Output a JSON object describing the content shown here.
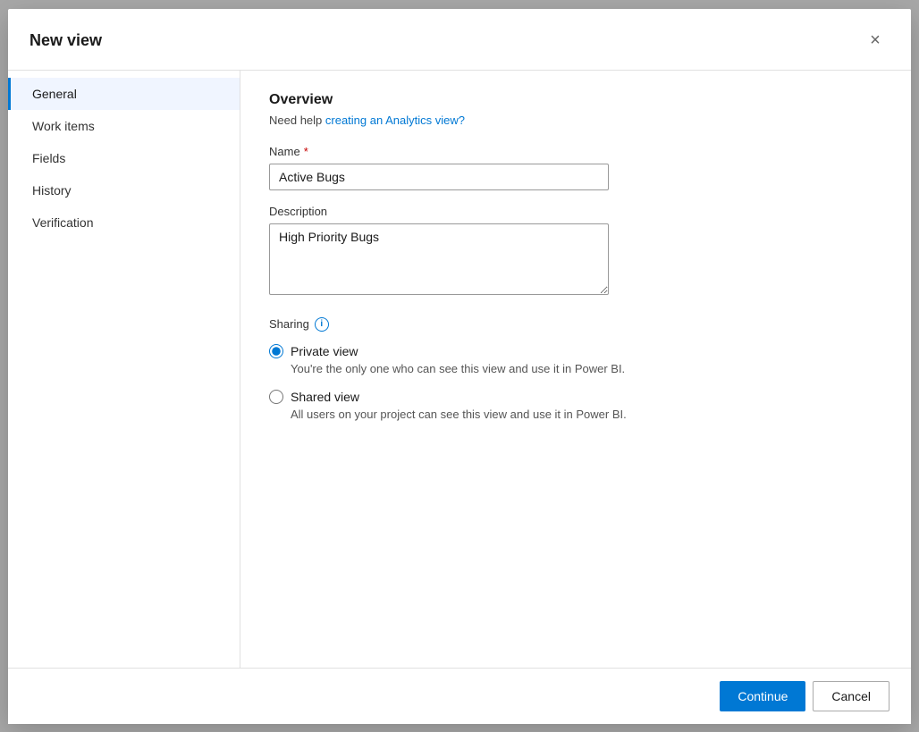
{
  "dialog": {
    "title": "New view",
    "close_label": "×"
  },
  "sidebar": {
    "items": [
      {
        "id": "general",
        "label": "General",
        "active": true
      },
      {
        "id": "work-items",
        "label": "Work items",
        "active": false
      },
      {
        "id": "fields",
        "label": "Fields",
        "active": false
      },
      {
        "id": "history",
        "label": "History",
        "active": false
      },
      {
        "id": "verification",
        "label": "Verification",
        "active": false
      }
    ]
  },
  "content": {
    "section_title": "Overview",
    "help_text_prefix": "Need help ",
    "help_link_label": "creating an Analytics view?",
    "help_link_href": "#",
    "name_label": "Name",
    "name_required": true,
    "name_value": "Active Bugs",
    "name_placeholder": "",
    "description_label": "Description",
    "description_value": "High Priority Bugs",
    "description_placeholder": "",
    "sharing_label": "Sharing",
    "info_icon_label": "i",
    "sharing_options": [
      {
        "id": "private",
        "label": "Private view",
        "description": "You're the only one who can see this view and use it in Power BI.",
        "checked": true
      },
      {
        "id": "shared",
        "label": "Shared view",
        "description": "All users on your project can see this view and use it in Power BI.",
        "checked": false
      }
    ]
  },
  "footer": {
    "continue_label": "Continue",
    "cancel_label": "Cancel"
  }
}
